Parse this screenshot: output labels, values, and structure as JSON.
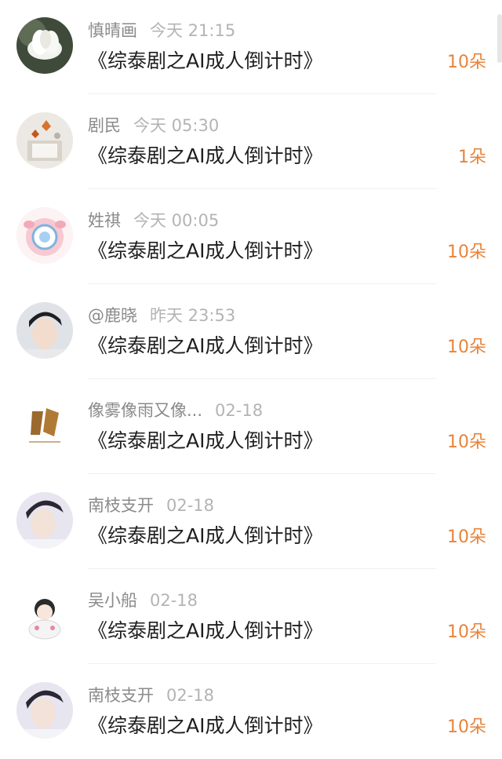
{
  "list": [
    {
      "name": "慎晴画",
      "time": "今天 21:15",
      "title": "《综泰剧之AI成人倒计时》",
      "count": "10朵",
      "avatar": "white-flower-avatar"
    },
    {
      "name": "剧民",
      "time": "今天 05:30",
      "title": "《综泰剧之AI成人倒计时》",
      "count": "1朵",
      "avatar": "autumn-leaves-avatar"
    },
    {
      "name": "姓祺",
      "time": "今天 00:05",
      "title": "《综泰剧之AI成人倒计时》",
      "count": "10朵",
      "avatar": "cartoon-sticker-avatar"
    },
    {
      "name": "@鹿晓",
      "time": "昨天 23:53",
      "title": "《综泰剧之AI成人倒计时》",
      "count": "10朵",
      "avatar": "portrait-avatar"
    },
    {
      "name": "像雾像雨又像...",
      "time": "02-18",
      "title": "《综泰剧之AI成人倒计时》",
      "count": "10朵",
      "avatar": "calligraphy-avatar"
    },
    {
      "name": "南枝支开",
      "time": "02-18",
      "title": "《综泰剧之AI成人倒计时》",
      "count": "10朵",
      "avatar": "portrait-avatar"
    },
    {
      "name": "吴小船",
      "time": "02-18",
      "title": "《综泰剧之AI成人倒计时》",
      "count": "10朵",
      "avatar": "chibi-avatar"
    },
    {
      "name": "南枝支开",
      "time": "02-18",
      "title": "《综泰剧之AI成人倒计时》",
      "count": "10朵",
      "avatar": "portrait-avatar"
    }
  ]
}
